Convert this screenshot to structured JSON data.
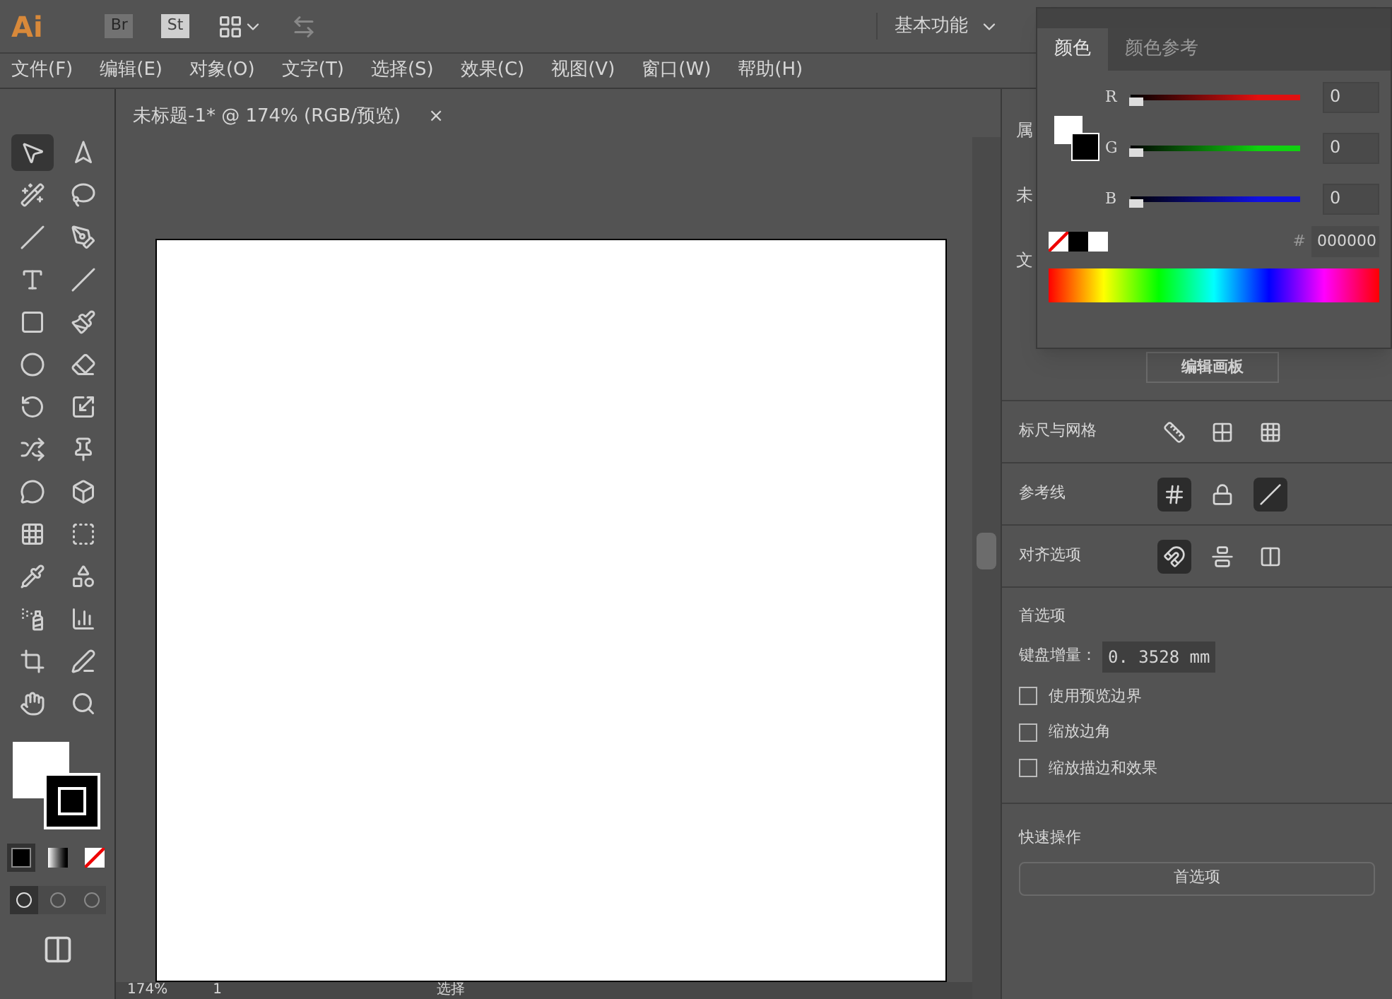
{
  "app_bar": {
    "logo": "Ai",
    "bridge": "Br",
    "stock": "St",
    "workspace": "基本功能"
  },
  "menu": [
    "文件(F)",
    "编辑(E)",
    "对象(O)",
    "文字(T)",
    "选择(S)",
    "效果(C)",
    "视图(V)",
    "窗口(W)",
    "帮助(H)"
  ],
  "document_tab": {
    "title": "未标题-1* @ 174% (RGB/预览)",
    "close": "×"
  },
  "tools": [
    {
      "selected": true
    },
    {
      "selected": false
    },
    {
      "selected": false
    },
    {
      "selected": false
    },
    {
      "selected": false
    },
    {
      "selected": false
    },
    {
      "selected": false
    },
    {
      "selected": false
    },
    {
      "selected": false
    },
    {
      "selected": false
    },
    {
      "selected": false
    },
    {
      "selected": false
    },
    {
      "selected": false
    },
    {
      "selected": false
    },
    {
      "selected": false
    },
    {
      "selected": false
    },
    {
      "selected": false
    },
    {
      "selected": false
    },
    {
      "selected": false
    },
    {
      "selected": false
    },
    {
      "selected": false
    },
    {
      "selected": false
    },
    {
      "selected": false
    },
    {
      "selected": false
    },
    {
      "selected": false
    },
    {
      "selected": false
    },
    {
      "selected": false
    },
    {
      "selected": false
    }
  ],
  "color_modes": [
    {
      "kind": "color",
      "selected": true
    },
    {
      "kind": "gradient",
      "selected": false
    },
    {
      "kind": "none",
      "selected": false
    }
  ],
  "draw_modes": [
    {
      "selected": true
    },
    {
      "selected": false
    },
    {
      "selected": false
    }
  ],
  "status_bar": {
    "zoom": "174%",
    "artboard": "1",
    "tool": "选择"
  },
  "properties_panel": {
    "peek": [
      "属",
      "未",
      "文"
    ],
    "edit_button": "编辑画板",
    "sections": [
      {
        "label": "标尺与网格",
        "toggles": [
          {
            "selected": false
          },
          {
            "selected": false
          },
          {
            "selected": false
          }
        ]
      },
      {
        "label": "参考线",
        "toggles": [
          {
            "selected": true
          },
          {
            "selected": false
          },
          {
            "selected": true
          }
        ]
      },
      {
        "label": "对齐选项",
        "toggles": [
          {
            "selected": true
          },
          {
            "selected": false
          },
          {
            "selected": false
          }
        ]
      }
    ],
    "preferences": {
      "title": "首选项",
      "increment_label": "键盘增量：",
      "increment_value": "0. 3528 mm",
      "checkboxes": [
        {
          "label": "使用预览边界",
          "checked": false
        },
        {
          "label": "缩放边角",
          "checked": false
        },
        {
          "label": "缩放描边和效果",
          "checked": false
        }
      ]
    },
    "quick_actions": {
      "title": "快速操作",
      "button": "首选项"
    }
  },
  "color_panel": {
    "tabs": [
      {
        "label": "颜色",
        "selected": true
      },
      {
        "label": "颜色参考",
        "selected": false
      }
    ],
    "channels": [
      {
        "name": "R",
        "level": 0,
        "value": "0",
        "color": "#e01010"
      },
      {
        "name": "G",
        "level": 0,
        "value": "0",
        "color": "#10d010"
      },
      {
        "name": "B",
        "level": 0,
        "value": "0",
        "color": "#1010e0"
      }
    ],
    "hex_label": "#",
    "hex": "000000"
  }
}
